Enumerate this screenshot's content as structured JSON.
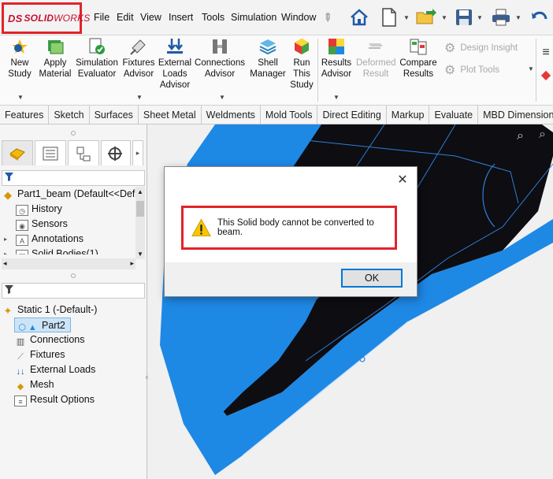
{
  "app": {
    "brand_prefix": "DS",
    "brand_solid": "SOLID",
    "brand_works": "WORKS"
  },
  "menu": [
    "File",
    "Edit",
    "View",
    "Insert",
    "Tools",
    "Simulation",
    "Window"
  ],
  "ribbon": {
    "commands": [
      {
        "label": "New Study",
        "icon": "new-study-icon"
      },
      {
        "label": "Apply Material",
        "icon": "apply-material-icon"
      },
      {
        "label": "Simulation Evaluator",
        "icon": "simulation-evaluator-icon"
      },
      {
        "label": "Fixtures Advisor",
        "icon": "fixtures-advisor-icon"
      },
      {
        "label": "External Loads Advisor",
        "icon": "external-loads-icon"
      },
      {
        "label": "Connections Advisor",
        "icon": "connections-icon"
      },
      {
        "label": "Shell Manager",
        "icon": "shell-manager-icon"
      },
      {
        "label": "Run This Study",
        "icon": "run-study-icon"
      },
      {
        "label": "Results Advisor",
        "icon": "results-advisor-icon"
      },
      {
        "label": "Deformed Result",
        "icon": "deformed-result-icon"
      },
      {
        "label": "Compare Results",
        "icon": "compare-results-icon"
      }
    ],
    "design_insight": "Design Insight",
    "plot_tools": "Plot Tools"
  },
  "tabs": [
    "Features",
    "Sketch",
    "Surfaces",
    "Sheet Metal",
    "Weldments",
    "Mold Tools",
    "Direct Editing",
    "Markup",
    "Evaluate",
    "MBD Dimensions"
  ],
  "feature_tree": {
    "root": "Part1_beam  (Default<<Def",
    "items": [
      "History",
      "Sensors",
      "Annotations",
      "Solid Bodies(1)"
    ]
  },
  "study_tree": {
    "root": "Static 1 (-Default-)",
    "items": [
      "Part2",
      "Connections",
      "Fixtures",
      "External Loads",
      "Mesh",
      "Result Options"
    ]
  },
  "dialog": {
    "message": "This Solid body cannot be converted to beam.",
    "ok_label": "OK",
    "close_glyph": "✕"
  },
  "colors": {
    "accent": "#0078d7",
    "highlight": "#e0242b",
    "model_blue": "#1e88e5"
  }
}
